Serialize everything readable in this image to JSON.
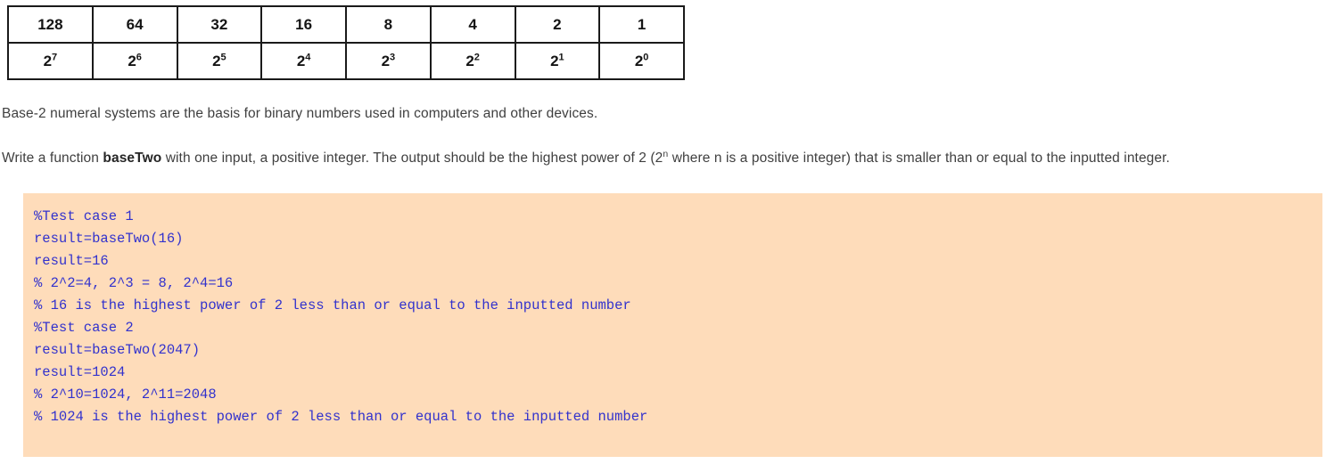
{
  "colors": {
    "code_background": "#fedcba",
    "code_text": "#3232cd",
    "prose_text": "#3f3f3f",
    "table_border": "#1a1a1a",
    "page_background": "#ffffff"
  },
  "powers_table": {
    "rows": [
      {
        "name": "decimal-values-row",
        "cells": [
          "128",
          "64",
          "32",
          "16",
          "8",
          "4",
          "2",
          "1"
        ]
      },
      {
        "name": "power-notation-row",
        "cells": [
          {
            "base": "2",
            "exponent": "7"
          },
          {
            "base": "2",
            "exponent": "6"
          },
          {
            "base": "2",
            "exponent": "5"
          },
          {
            "base": "2",
            "exponent": "4"
          },
          {
            "base": "2",
            "exponent": "3"
          },
          {
            "base": "2",
            "exponent": "2"
          },
          {
            "base": "2",
            "exponent": "1"
          },
          {
            "base": "2",
            "exponent": "0"
          }
        ]
      }
    ]
  },
  "prose": {
    "intro": "Base-2 numeral systems are the basis for binary numbers used in computers and other devices.",
    "task": {
      "part1": "Write a function ",
      "function_name": "baseTwo",
      "part2": " with one input, a positive integer. The output should be the highest power of 2 (2",
      "exponent": "n",
      "part3": " where n is a positive integer) that is smaller than or equal to the inputted integer."
    }
  },
  "code_block": {
    "language": "matlab",
    "lines": [
      "%Test case 1",
      "result=baseTwo(16)",
      "result=16",
      "% 2^2=4, 2^3 = 8, 2^4=16",
      "% 16 is the highest power of 2 less than or equal to the inputted number",
      "%Test case 2",
      "result=baseTwo(2047)",
      "result=1024",
      "% 2^10=1024, 2^11=2048",
      "% 1024 is the highest power of 2 less than or equal to the inputted number"
    ]
  }
}
